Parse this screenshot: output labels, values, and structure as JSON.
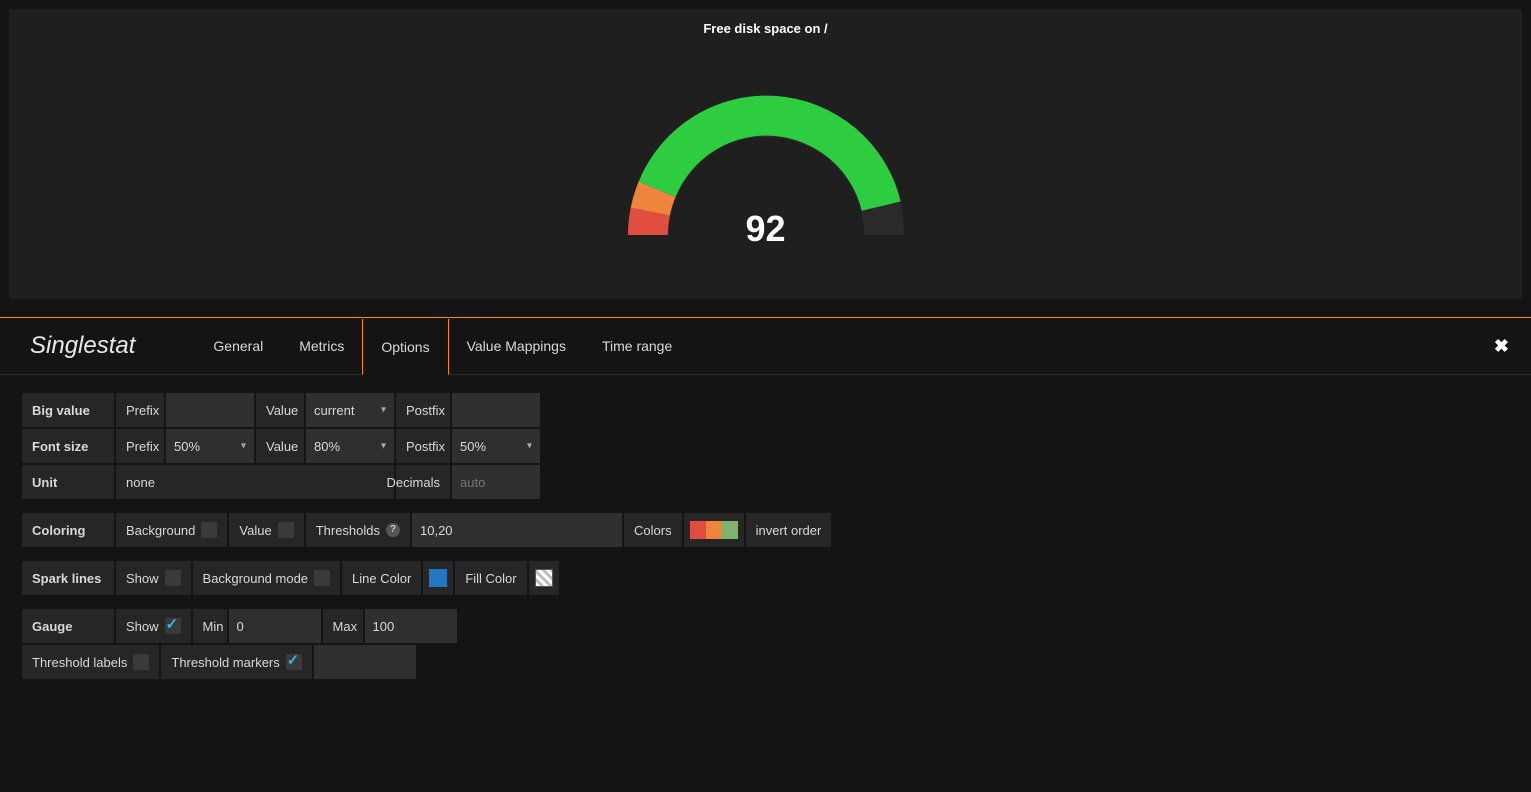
{
  "panel": {
    "title": "Free disk space on /",
    "value": "92"
  },
  "chart_data": {
    "type": "gauge",
    "value": 92,
    "min": 0,
    "max": 100,
    "thresholds": [
      10,
      20
    ],
    "colors": [
      "#e24d42",
      "#ef843c",
      "#2ecc40"
    ],
    "title": "Free disk space on /"
  },
  "editor": {
    "title": "Singlestat",
    "tabs": {
      "general": "General",
      "metrics": "Metrics",
      "options": "Options",
      "value_mappings": "Value Mappings",
      "time_range": "Time range"
    },
    "active_tab": "options",
    "close": "✕"
  },
  "bigvalue": {
    "section": "Big value",
    "prefix_label": "Prefix",
    "prefix_value": "",
    "value_label": "Value",
    "value_select": "current",
    "postfix_label": "Postfix",
    "postfix_value": ""
  },
  "fontsize": {
    "section": "Font size",
    "prefix_label": "Prefix",
    "prefix_select": "50%",
    "value_label": "Value",
    "value_select": "80%",
    "postfix_label": "Postfix",
    "postfix_select": "50%"
  },
  "unit": {
    "section": "Unit",
    "unit_value": "none",
    "decimals_label": "Decimals",
    "decimals_placeholder": "auto",
    "decimals_value": ""
  },
  "coloring": {
    "section": "Coloring",
    "background_label": "Background",
    "background_checked": false,
    "value_label": "Value",
    "value_checked": false,
    "thresholds_label": "Thresholds",
    "thresholds_value": "10,20",
    "colors_label": "Colors",
    "invert_label": "invert order"
  },
  "spark": {
    "section": "Spark lines",
    "show_label": "Show",
    "show_checked": false,
    "bgmode_label": "Background mode",
    "bgmode_checked": false,
    "linecolor_label": "Line Color",
    "fillcolor_label": "Fill Color"
  },
  "gauge": {
    "section": "Gauge",
    "show_label": "Show",
    "show_checked": true,
    "min_label": "Min",
    "min_value": "0",
    "max_label": "Max",
    "max_value": "100",
    "thr_labels_label": "Threshold labels",
    "thr_labels_checked": false,
    "thr_markers_label": "Threshold markers",
    "thr_markers_checked": true
  }
}
